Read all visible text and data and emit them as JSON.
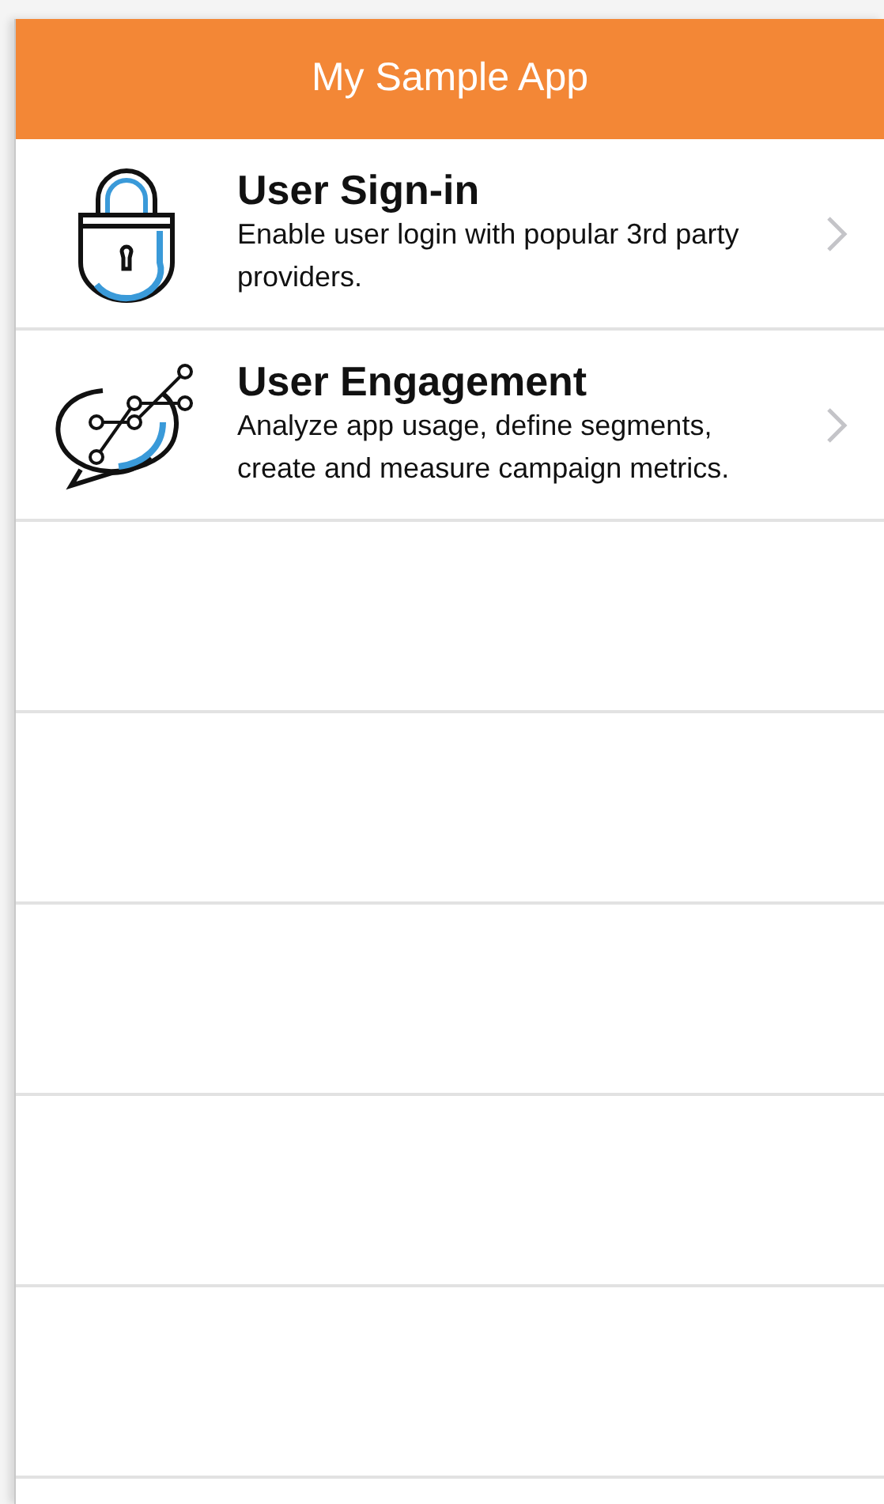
{
  "header": {
    "title": "My Sample App"
  },
  "items": [
    {
      "kind": "lock",
      "title": "User Sign-in",
      "description": "Enable user login with popular 3rd party providers."
    },
    {
      "kind": "chat-graph",
      "title": "User Engagement",
      "description": "Analyze app usage, define segments, create and measure campaign metrics."
    }
  ]
}
